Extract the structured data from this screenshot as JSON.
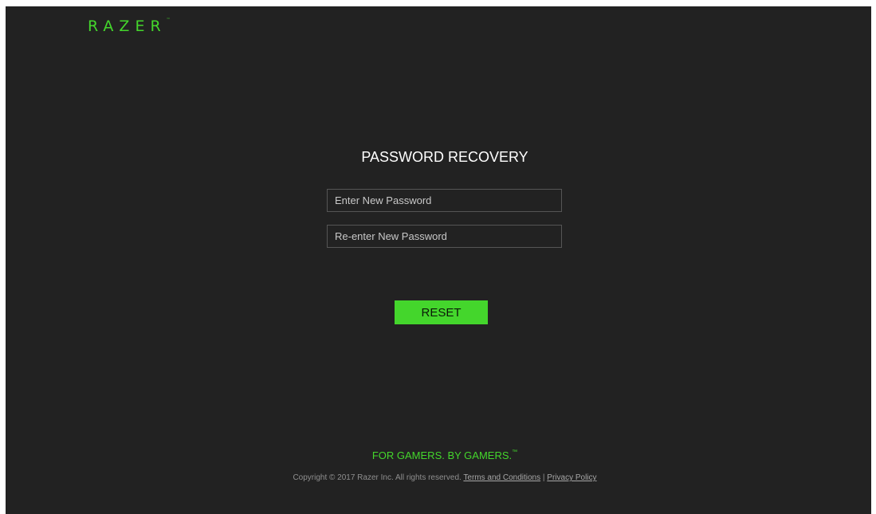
{
  "brand": {
    "logo_text": "RAZER",
    "logo_tm": "™",
    "accent_color": "#44d62c"
  },
  "form": {
    "title": "PASSWORD RECOVERY",
    "new_password": {
      "placeholder": "Enter New Password",
      "value": ""
    },
    "confirm_password": {
      "placeholder": "Re-enter New Password",
      "value": ""
    },
    "reset_label": "RESET"
  },
  "footer": {
    "tagline": "FOR GAMERS. BY GAMERS.",
    "tagline_tm": "™",
    "copyright": "Copyright © 2017 Razer Inc. All rights reserved.",
    "terms_label": "Terms and Conditions",
    "separator": "|",
    "privacy_label": "Privacy Policy"
  }
}
